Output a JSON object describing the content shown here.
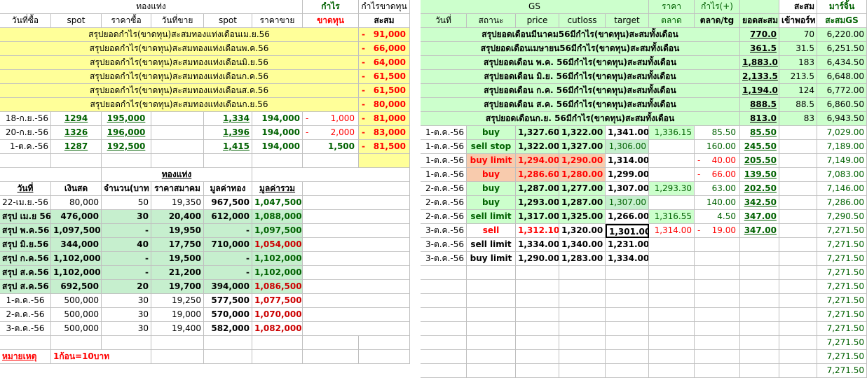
{
  "left": {
    "section_title": "ทองแท่ง",
    "hdr_profit": "กำไร",
    "hdr_cum_top": "กำไรขาดทุน",
    "hdr": [
      "วันที่ซื้อ",
      "spot",
      "ราคาซื้อ",
      "วันที่ขาย",
      "spot",
      "ราคาขาย",
      "ขาดทุน",
      "สะสม"
    ],
    "summary": [
      {
        "label": "สรุปยอดกำไร(ขาดทุน)สะสมทองแท่งเดือนเม.ย.56",
        "dash": "-",
        "value": "91,000"
      },
      {
        "label": "สรุปยอดกำไร(ขาดทุน)สะสมทองแท่งเดือนพ.ค.56",
        "dash": "-",
        "value": "66,000"
      },
      {
        "label": "สรุปยอดกำไร(ขาดทุน)สะสมทองแท่งเดือนมิ.ย.56",
        "dash": "-",
        "value": "64,000"
      },
      {
        "label": "สรุปยอดกำไร(ขาดทุน)สะสมทองแท่งเดือนก.ค.56",
        "dash": "-",
        "value": "61,500"
      },
      {
        "label": "สรุปยอดกำไร(ขาดทุน)สะสมทองแท่งเดือนส.ค.56",
        "dash": "-",
        "value": "61,500"
      },
      {
        "label": "สรุปยอดกำไร(ขาดทุน)สะสมทองแท่งเดือนก.ย.56",
        "dash": "-",
        "value": "80,000"
      }
    ],
    "trades": [
      {
        "date": "18-ก.ย.-56",
        "spot": "1294",
        "buy": "195,000",
        "sdate": "",
        "sspot": "1,334",
        "sell": "194,000",
        "dash": "-",
        "pl": "1,000",
        "dash2": "-",
        "cum": "81,000"
      },
      {
        "date": "20-ก.ย.-56",
        "spot": "1326",
        "buy": "196,000",
        "sdate": "",
        "sspot": "1,396",
        "sell": "194,000",
        "dash": "-",
        "pl": "2,000",
        "dash2": "-",
        "cum": "83,000"
      },
      {
        "date": "1-ต.ค.-56",
        "spot": "1287",
        "buy": "192,500",
        "sdate": "",
        "sspot": "1,415",
        "sell": "194,000",
        "dash": "",
        "pl": "1,500",
        "dash2": "-",
        "cum": "81,500"
      }
    ],
    "bar_title": "ทองแท่ง",
    "hdr2": [
      "วันที่",
      "เงินสด",
      "จำนวน(บาท",
      "ราคาสมาคม",
      "มูลค่าทอง",
      "มูลค่ารวม"
    ],
    "cash_rows": [
      {
        "d": "22-เม.ย.-56",
        "cash": "80,000",
        "qty": "50",
        "price": "19,350",
        "gold": "967,500",
        "total": "1,047,500",
        "sum": false,
        "red": false
      },
      {
        "d": "สรุป เม.ย 56",
        "cash": "476,000",
        "qty": "30",
        "price": "20,400",
        "gold": "612,000",
        "total": "1,088,000",
        "sum": true,
        "red": false
      },
      {
        "d": "สรุป พ.ค.56",
        "cash": "1,097,500",
        "qty": "-",
        "price": "19,950",
        "gold": "-",
        "total": "1,097,500",
        "sum": true,
        "red": false
      },
      {
        "d": "สรุป มิ.ย.56",
        "cash": "344,000",
        "qty": "40",
        "price": "17,750",
        "gold": "710,000",
        "total": "1,054,000",
        "sum": true,
        "red": true
      },
      {
        "d": "สรุป ก.ค.56",
        "cash": "1,102,000",
        "qty": "-",
        "price": "19,500",
        "gold": "-",
        "total": "1,102,000",
        "sum": true,
        "red": false
      },
      {
        "d": "สรุป ส.ค.56",
        "cash": "1,102,000",
        "qty": "-",
        "price": "21,200",
        "gold": "-",
        "total": "1,102,000",
        "sum": true,
        "red": false
      },
      {
        "d": "สรุป ส.ค.56",
        "cash": "692,500",
        "qty": "20",
        "price": "19,700",
        "gold": "394,000",
        "total": "1,086,500",
        "sum": true,
        "red": true
      },
      {
        "d": "1-ต.ค.-56",
        "cash": "500,000",
        "qty": "30",
        "price": "19,250",
        "gold": "577,500",
        "total": "1,077,500",
        "sum": false,
        "red": true
      },
      {
        "d": "2-ต.ค.-56",
        "cash": "500,000",
        "qty": "30",
        "price": "19,000",
        "gold": "570,000",
        "total": "1,070,000",
        "sum": false,
        "red": true
      },
      {
        "d": "3-ต.ค.-56",
        "cash": "500,000",
        "qty": "30",
        "price": "19,400",
        "gold": "582,000",
        "total": "1,082,000",
        "sum": false,
        "red": true
      }
    ],
    "note_label": "หมายเหตุ",
    "note_text": "1ก้อน=10บาท"
  },
  "right": {
    "gs_title": "GS",
    "h_price_top": "ราคา",
    "h_profit_top": "กำไร(+)",
    "h_cum_top": "สะสม",
    "h_mr_top": "มาร์จิ้น",
    "hdr": [
      "วันที่",
      "สถานะ",
      "price",
      "cutloss",
      "target",
      "ตลาด",
      "ตลาด/tg",
      "ยอดสะสม",
      "เข้าพอร์ท",
      "สะสมGS"
    ],
    "summary": [
      {
        "label": "สรุปยอดเดือนมีนาคม56มีกำไร(ขาดทุน)สะสมทั้งเดือน",
        "cum": "770.0",
        "port": "70",
        "gs": "6,220.00"
      },
      {
        "label": "สรุปยอดเดือนเมษายน56มีกำไร(ขาดทุน)สะสมทั้งเดือน",
        "cum": "361.5",
        "port": "31.5",
        "gs": "6,251.50"
      },
      {
        "label": "สรุปยอดเดือน พ.ค. 56มีกำไร(ขาดทุน)สะสมทั้งเดือน",
        "cum": "1,883.0",
        "port": "183",
        "gs": "6,434.50"
      },
      {
        "label": "สรุปยอดเดือน มิ.ย. 56มีกำไร(ขาดทุน)สะสมทั้งเดือน",
        "cum": "2,133.5",
        "port": "213.5",
        "gs": "6,648.00"
      },
      {
        "label": "สรุปยอดเดือน ก.ค. 56มีกำไร(ขาดทุน)สะสมทั้งเดือน",
        "cum": "1,194.0",
        "port": "124",
        "gs": "6,772.00"
      },
      {
        "label": "สรุปยอดเดือน ส.ค. 56มีกำไร(ขาดทุน)สะสมทั้งเดือน",
        "cum": "888.5",
        "port": "88.5",
        "gs": "6,860.50"
      },
      {
        "label": "สรุปยอดเดือนก.ย. 56มีกำไร(ขาดทุน)สะสมทั้งเดือน",
        "cum": "813.0",
        "port": "83",
        "gs": "6,943.50"
      }
    ],
    "trades": [
      {
        "d": "1-ต.ค.-56",
        "st": "buy",
        "price": "1,327.60",
        "cut": "1,322.00",
        "tg": "1,341.00",
        "mkt": "1,336.15",
        "dash": "",
        "pt": "85.50",
        "cum": "85.50",
        "port": "",
        "gs": "7,029.00",
        "kind": "green",
        "mktbg": true,
        "tgbg": false
      },
      {
        "d": "1-ต.ค.-56",
        "st": "sell stop",
        "price": "1,322.00",
        "cut": "1,327.00",
        "tg": "1,306.00",
        "mkt": "",
        "dash": "",
        "pt": "160.00",
        "cum": "245.50",
        "port": "",
        "gs": "7,189.00",
        "kind": "green",
        "mktbg": false,
        "tgbg": true
      },
      {
        "d": "1-ต.ค.-56",
        "st": "buy limit",
        "price": "1,294.00",
        "cut": "1,290.00",
        "tg": "1,314.00",
        "mkt": "",
        "dash": "-",
        "pt": "40.00",
        "cum": "205.50",
        "port": "",
        "gs": "7,149.00",
        "kind": "sal",
        "mktbg": false,
        "tgbg": false
      },
      {
        "d": "1-ต.ค.-56",
        "st": "buy",
        "price": "1,286.60",
        "cut": "1,280.00",
        "tg": "1,299.00",
        "mkt": "",
        "dash": "-",
        "pt": "66.00",
        "cum": "139.50",
        "port": "",
        "gs": "7,083.00",
        "kind": "sal",
        "mktbg": false,
        "tgbg": false
      },
      {
        "d": "2-ต.ค.-56",
        "st": "buy",
        "price": "1,287.00",
        "cut": "1,277.00",
        "tg": "1,307.00",
        "mkt": "1,293.30",
        "dash": "",
        "pt": "63.00",
        "cum": "202.50",
        "port": "",
        "gs": "7,146.00",
        "kind": "green",
        "mktbg": true,
        "tgbg": false
      },
      {
        "d": "2-ต.ค.-56",
        "st": "buy",
        "price": "1,293.00",
        "cut": "1,287.00",
        "tg": "1,307.00",
        "mkt": "",
        "dash": "",
        "pt": "140.00",
        "cum": "342.50",
        "port": "",
        "gs": "7,286.00",
        "kind": "green",
        "mktbg": false,
        "tgbg": true
      },
      {
        "d": "2-ต.ค.-56",
        "st": "sell limit",
        "price": "1,317.00",
        "cut": "1,325.00",
        "tg": "1,266.00",
        "mkt": "1,316.55",
        "dash": "",
        "pt": "4.50",
        "cum": "347.00",
        "port": "",
        "gs": "7,290.50",
        "kind": "green",
        "mktbg": true,
        "tgbg": false
      },
      {
        "d": "3-ต.ค.-56",
        "st": "sell",
        "price": "1,312.10",
        "cut": "1,320.00",
        "tg": "1,301.00",
        "mkt": "1,314.00",
        "dash": "-",
        "pt": "19.00",
        "cum": "347.00",
        "port": "",
        "gs": "7,271.50",
        "kind": "redtxt",
        "mktbg": false,
        "tgbg": false
      },
      {
        "d": "3-ต.ค.-56",
        "st": "sell limit",
        "price": "1,334.00",
        "cut": "1,340.00",
        "tg": "1,231.00",
        "mkt": "",
        "dash": "",
        "pt": "",
        "cum": "",
        "port": "",
        "gs": "7,271.50",
        "kind": "plain",
        "mktbg": false,
        "tgbg": false
      },
      {
        "d": "3-ต.ค.-56",
        "st": "buy limit",
        "price": "1,290.00",
        "cut": "1,283.00",
        "tg": "1,334.00",
        "mkt": "",
        "dash": "",
        "pt": "",
        "cum": "",
        "port": "",
        "gs": "7,271.50",
        "kind": "plain",
        "mktbg": false,
        "tgbg": false
      }
    ],
    "tail_gs": [
      "7,271.50",
      "7,271.50",
      "7,271.50",
      "7,271.50",
      "7,271.50",
      "7,271.50",
      "7,271.50",
      "7,271.50"
    ]
  }
}
